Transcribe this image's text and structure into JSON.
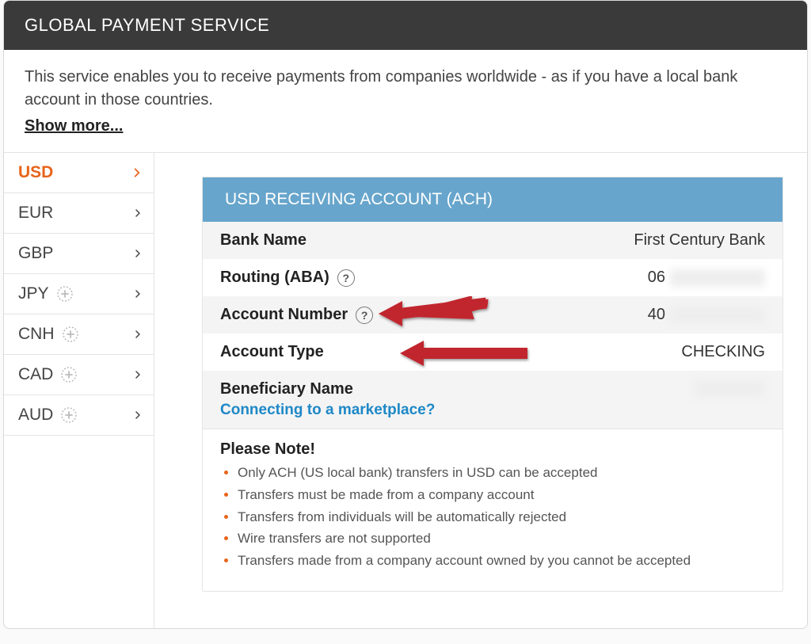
{
  "header": {
    "title": "GLOBAL PAYMENT SERVICE"
  },
  "intro": {
    "text": "This service enables you to receive payments from companies worldwide - as if you have a local bank account in those countries.",
    "show_more": "Show more..."
  },
  "sidebar": {
    "items": [
      {
        "code": "USD",
        "has_plus": false,
        "selected": true
      },
      {
        "code": "EUR",
        "has_plus": false,
        "selected": false
      },
      {
        "code": "GBP",
        "has_plus": false,
        "selected": false
      },
      {
        "code": "JPY",
        "has_plus": true,
        "selected": false
      },
      {
        "code": "CNH",
        "has_plus": true,
        "selected": false
      },
      {
        "code": "CAD",
        "has_plus": true,
        "selected": false
      },
      {
        "code": "AUD",
        "has_plus": true,
        "selected": false
      }
    ]
  },
  "panel": {
    "title": "USD RECEIVING ACCOUNT (ACH)",
    "rows": {
      "bank_name": {
        "label": "Bank Name",
        "value": "First Century Bank"
      },
      "routing": {
        "label": "Routing (ABA)",
        "value_prefix": "06"
      },
      "account_number": {
        "label": "Account Number",
        "value_prefix": "40"
      },
      "account_type": {
        "label": "Account Type",
        "value": "CHECKING"
      },
      "beneficiary": {
        "label": "Beneficiary Name",
        "sublink": "Connecting to a marketplace?"
      }
    },
    "note": {
      "title": "Please Note!",
      "items": [
        "Only ACH (US local bank) transfers in USD can be accepted",
        "Transfers must be made from a company account",
        "Transfers from individuals will be automatically rejected",
        "Wire transfers are not supported",
        "Transfers made from a company account owned by you cannot be accepted"
      ]
    }
  }
}
